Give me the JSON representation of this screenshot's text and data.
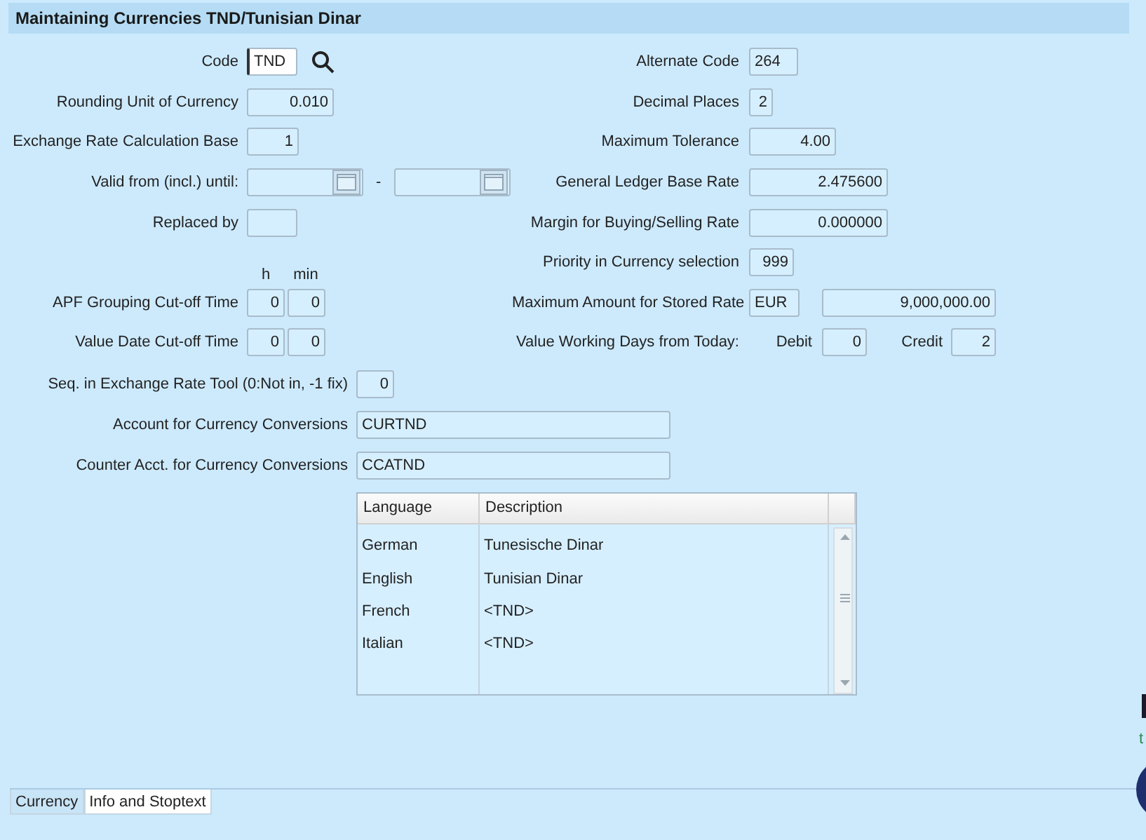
{
  "title": "Maintaining Currencies TND/Tunisian Dinar",
  "code": {
    "label": "Code",
    "value": "TND"
  },
  "rounding_unit": {
    "label": "Rounding Unit of Currency",
    "value": "0.010"
  },
  "calc_base": {
    "label": "Exchange Rate Calculation Base",
    "value": "1"
  },
  "valid": {
    "label": "Valid from (incl.) until:",
    "separator": "-"
  },
  "replaced_by": {
    "label": "Replaced by"
  },
  "time_headers": [
    "h",
    "min"
  ],
  "apf_cutoff": {
    "label": "APF Grouping Cut-off Time",
    "hours": "0",
    "minutes": "0"
  },
  "value_date_cutoff": {
    "label": "Value Date Cut-off Time",
    "hours": "0",
    "minutes": "0"
  },
  "alternate_code": {
    "label": "Alternate Code",
    "value": "264"
  },
  "decimal_places": {
    "label": "Decimal Places",
    "value": "2"
  },
  "max_tolerance": {
    "label": "Maximum Tolerance",
    "value": "4.00"
  },
  "gl_base_rate": {
    "label": "General Ledger Base Rate",
    "value": "2.475600"
  },
  "margin": {
    "label": "Margin for Buying/Selling Rate",
    "value": "0.000000"
  },
  "priority": {
    "label": "Priority in Currency selection",
    "value": "999"
  },
  "max_amount": {
    "label": "Maximum Amount for Stored Rate",
    "currency": "EUR",
    "value": "9,000,000.00"
  },
  "value_days": {
    "label": "Value Working Days from Today:",
    "debit_label": "Debit",
    "debit": "0",
    "credit_label": "Credit",
    "credit": "2"
  },
  "seq_rate_tool": {
    "label": "Seq. in Exchange Rate Tool (0:Not in, -1 fix)",
    "value": "0"
  },
  "account": {
    "label": "Account for Currency Conversions",
    "value": "CURTND"
  },
  "counter_account": {
    "label": "Counter Acct. for Currency Conversions",
    "value": "CCATND"
  },
  "descriptions": {
    "columns": [
      "Language",
      "Description"
    ],
    "rows": [
      {
        "language": "German",
        "description": "Tunesische Dinar"
      },
      {
        "language": "English",
        "description": "Tunisian Dinar"
      },
      {
        "language": "French",
        "description": "<TND>"
      },
      {
        "language": "Italian",
        "description": "<TND>"
      }
    ]
  },
  "tabs": [
    {
      "label": "Currency",
      "selected": false
    },
    {
      "label": "Info and Stoptext",
      "selected": true
    }
  ],
  "edge_text": "t"
}
